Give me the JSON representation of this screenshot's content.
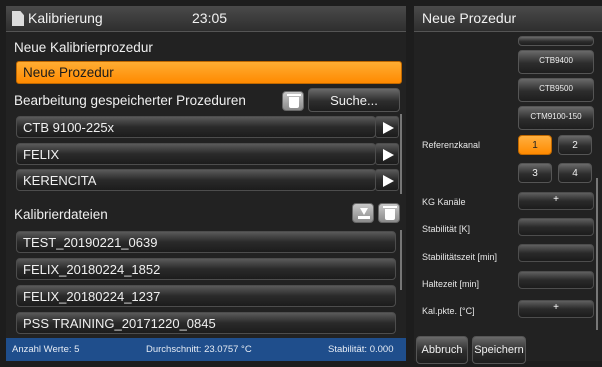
{
  "left_panel": {
    "title": "Kalibrierung",
    "time": "23:05",
    "new_section_label": "Neue Kalibrierprozedur",
    "new_procedure_label": "Neue Prozedur",
    "edit_section_label": "Bearbeitung gespeicherter Prozeduren",
    "search_label": "Suche...",
    "procedures": [
      "CTB 9100-225x",
      "FELIX",
      "KERENCITA"
    ],
    "files_section_label": "Kalibrierdateien",
    "files": [
      "TEST_20190221_0639",
      "FELIX_20180224_1852",
      "FELIX_20180224_1237",
      "PSS TRAINING_20171220_0845"
    ],
    "status": {
      "count": "Anzahl Werte: 5",
      "average": "Durchschnitt: 23.0757 °C",
      "stability": "Stabilität: 0.000"
    }
  },
  "right_panel": {
    "title": "Neue Prozedur",
    "devices": [
      "",
      "CTB9400",
      "CTB9500",
      "CTM9100-150"
    ],
    "reference_channel_label": "Referenzkanal",
    "channels": [
      "1",
      "2",
      "3",
      "4"
    ],
    "active_channel": "1",
    "kg_channels_label": "KG Kanäle",
    "kg_channels_value": "+",
    "stability_label": "Stabilität [K]",
    "stability_time_label": "Stabilitätszeit [min]",
    "hold_time_label": "Haltezeit [min]",
    "cal_points_label": "Kal.pkte. [°C]",
    "cal_points_value": "+",
    "cancel_label": "Abbruch",
    "save_label": "Speichern"
  },
  "colors": {
    "accent_orange": "#ff8a00",
    "statusbar_blue": "#1f4e8c"
  }
}
